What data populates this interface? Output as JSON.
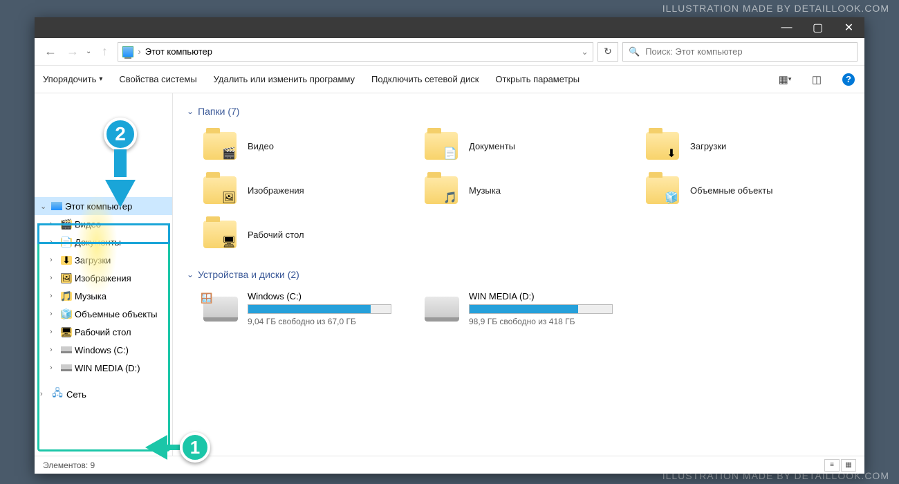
{
  "watermark_top": "ILLUSTRATION MADE BY DETAILLOOK.COM",
  "watermark_bottom": "ILLUSTRATION MADE BY DETAILLOOK.COM",
  "titlebar": {
    "minimize": "—",
    "maximize": "▢",
    "close": "✕"
  },
  "address": {
    "location": "Этот компьютер",
    "chevron": "›",
    "dropdown": "⌄",
    "refresh": "↻"
  },
  "search": {
    "icon": "🔍",
    "placeholder": "Поиск: Этот компьютер"
  },
  "toolbar": {
    "organize": "Упорядочить",
    "system_props": "Свойства системы",
    "uninstall": "Удалить или изменить программу",
    "map_drive": "Подключить сетевой диск",
    "open_settings": "Открыть параметры"
  },
  "tree": {
    "this_pc": "Этот компьютер",
    "children": [
      {
        "label": "Видео"
      },
      {
        "label": "Документы"
      },
      {
        "label": "Загрузки"
      },
      {
        "label": "Изображения"
      },
      {
        "label": "Музыка"
      },
      {
        "label": "Объемные объекты"
      },
      {
        "label": "Рабочий стол"
      },
      {
        "label": "Windows (C:)"
      },
      {
        "label": "WIN MEDIA (D:)"
      }
    ],
    "network": "Сеть"
  },
  "sections": {
    "folders": "Папки (7)",
    "drives": "Устройства и диски (2)"
  },
  "folders": [
    {
      "label": "Видео",
      "icon": "🎬"
    },
    {
      "label": "Документы",
      "icon": "📄"
    },
    {
      "label": "Загрузки",
      "icon": "⬇"
    },
    {
      "label": "Изображения",
      "icon": "🖼"
    },
    {
      "label": "Музыка",
      "icon": "🎵"
    },
    {
      "label": "Объемные объекты",
      "icon": "🧊"
    },
    {
      "label": "Рабочий стол",
      "icon": "🖥"
    }
  ],
  "drives_data": [
    {
      "name": "Windows (C:)",
      "free": "9,04 ГБ свободно из 67,0 ГБ",
      "fill": 86,
      "win": true
    },
    {
      "name": "WIN MEDIA (D:)",
      "free": "98,9 ГБ свободно из 418 ГБ",
      "fill": 76,
      "win": false
    }
  ],
  "status": {
    "count": "Элементов: 9"
  },
  "annotations": {
    "one": "1",
    "two": "2"
  }
}
